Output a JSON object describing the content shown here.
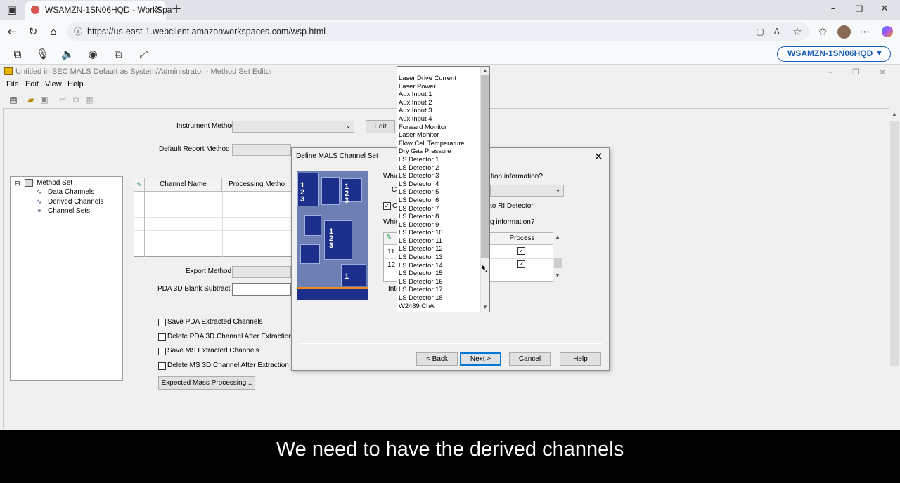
{
  "browser": {
    "tab_title": "WSAMZN-1SN06HQD - WorkSpa",
    "url": "https://us-east-1.webclient.amazonworkspaces.com/wsp.html",
    "workspace_chip": "WSAMZN-1SN06HQD"
  },
  "app": {
    "title": "Untitled in SEC MALS Default as System/Administrator - Method Set Editor",
    "menu": [
      "File",
      "Edit",
      "View",
      "Help"
    ],
    "instrument_method_label": "Instrument Method",
    "edit_button": "Edit",
    "default_report_label": "Default Report Method",
    "export_method_label": "Export Method",
    "pda_blank_label": "PDA 3D Blank Subtraction",
    "checkboxes": [
      "Save PDA Extracted Channels",
      "Delete PDA 3D Channel After Extraction",
      "Save MS Extracted Channels",
      "Delete MS 3D Channel After Extraction"
    ],
    "expected_mass_button": "Expected Mass Processing...",
    "tree": {
      "root": "Method Set",
      "children": [
        "Data Channels",
        "Derived Channels",
        "Channel Sets"
      ]
    },
    "grid_headers": [
      "Channel Name",
      "Processing Metho"
    ]
  },
  "dialog": {
    "title": "Define MALS Channel Set",
    "q1_start": "Whic",
    "q1_end": "tion information?",
    "combo_label": "C",
    "checkbox_start": "C",
    "checkbox_end": "to RI Detector",
    "q2_start": "Whic",
    "q2_end": "g information?",
    "process_header": "Process",
    "rows": [
      "11",
      "12"
    ],
    "inter_label": "Inte",
    "buttons": {
      "back": "< Back",
      "next": "Next >",
      "cancel": "Cancel",
      "help": "Help"
    },
    "image_numbers": [
      "1",
      "2",
      "3",
      "1",
      "2",
      "3",
      "1",
      "2",
      "3",
      "1"
    ]
  },
  "dropdown_items": [
    "Laser Drive Current",
    "Laser Power",
    "Aux Input 1",
    "Aux Input 2",
    "Aux Input 3",
    "Aux Input 4",
    "Forward Monitor",
    "Laser Monitor",
    "Flow Cell Temperature",
    "Dry Gas Pressure",
    "LS Detector 1",
    "LS Detector 2",
    "LS Detector 3",
    "LS Detector 4",
    "LS Detector 5",
    "LS Detector 6",
    "LS Detector 7",
    "LS Detector 8",
    "LS Detector 9",
    "LS Detector 10",
    "LS Detector 11",
    "LS Detector 12",
    "LS Detector 13",
    "LS Detector 14",
    "LS Detector 15",
    "LS Detector 16",
    "LS Detector 17",
    "LS Detector 18",
    "W2489 ChA"
  ],
  "subtitle": "We need to have the derived channels"
}
